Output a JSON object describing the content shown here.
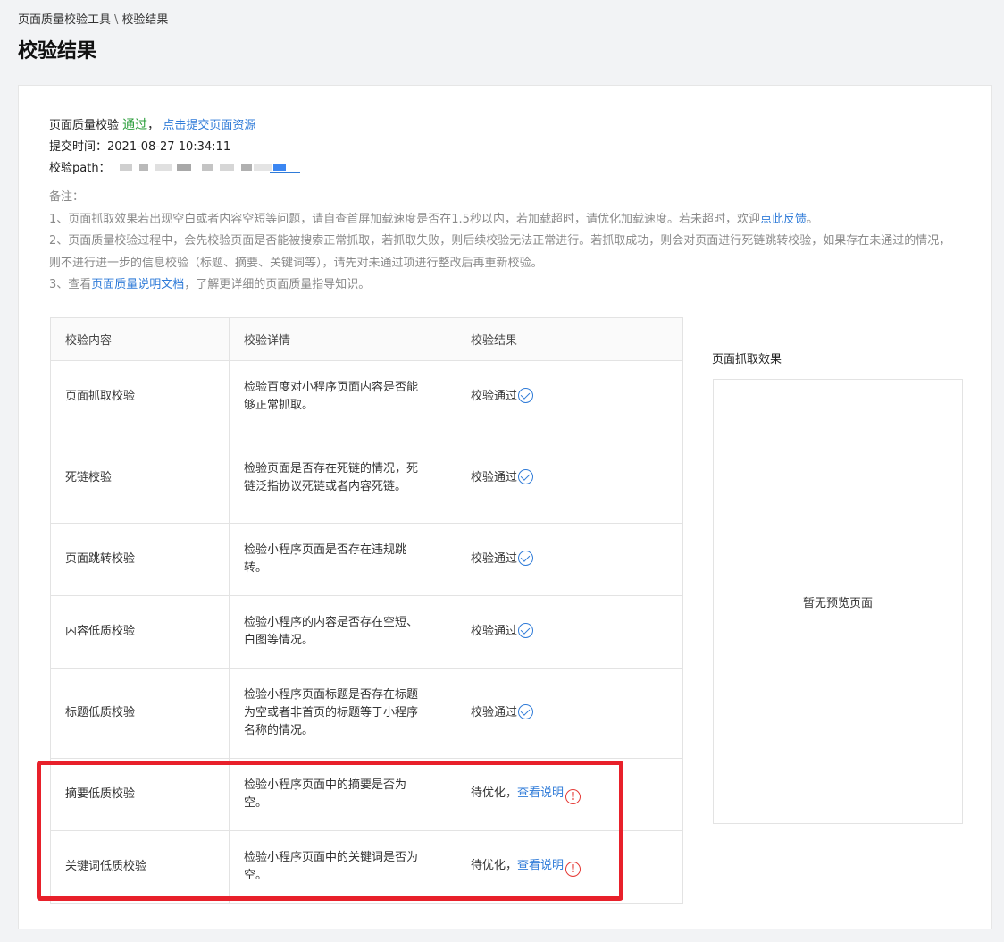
{
  "breadcrumb": {
    "root": "页面质量校验工具",
    "separator": "\\",
    "current": "校验结果"
  },
  "page_title": "校验结果",
  "summary": {
    "status_prefix": "页面质量校验",
    "status_word": "通过",
    "comma": "，",
    "submit_link": "点击提交页面资源",
    "submit_time_label": "提交时间：",
    "submit_time_value": "2021-08-27 10:34:11",
    "path_label": "校验path："
  },
  "notes": {
    "title": "备注：",
    "n1_text": "1、页面抓取效果若出现空白或者内容空短等问题，请自查首屏加载速度是否在1.5秒以内，若加载超时，请优化加载速度。若未超时，欢迎",
    "n1_link": "点此反馈",
    "n1_end": "。",
    "n2_text": "2、页面质量校验过程中，会先校验页面是否能被搜索正常抓取，若抓取失败，则后续校验无法正常进行。若抓取成功，则会对页面进行死链跳转校验，如果存在未通过的情况，则不进行进一步的信息校验（标题、摘要、关键词等），请先对未通过项进行整改后再重新校验。",
    "n3_start": "3、查看",
    "n3_link": "页面质量说明文档",
    "n3_end": "，了解更详细的页面质量指导知识。"
  },
  "table": {
    "headers": [
      "校验内容",
      "校验详情",
      "校验结果"
    ],
    "rows": [
      {
        "item": "页面抓取校验",
        "detail": "检验百度对小程序页面内容是否能够正常抓取。",
        "result": "校验通过",
        "status": "pass"
      },
      {
        "item": "死链校验",
        "detail": "检验页面是否存在死链的情况，死链泛指协议死链或者内容死链。",
        "result": "校验通过",
        "status": "pass"
      },
      {
        "item": "页面跳转校验",
        "detail": "检验小程序页面是否存在违规跳转。",
        "result": "校验通过",
        "status": "pass"
      },
      {
        "item": "内容低质校验",
        "detail": "检验小程序的内容是否存在空短、白图等情况。",
        "result": "校验通过",
        "status": "pass"
      },
      {
        "item": "标题低质校验",
        "detail": "检验小程序页面标题是否存在标题为空或者非首页的标题等于小程序名称的情况。",
        "result": "校验通过",
        "status": "pass"
      },
      {
        "item": "摘要低质校验",
        "detail": "检验小程序页面中的摘要是否为空。",
        "result": "待优化，",
        "link": "查看说明",
        "status": "warn"
      },
      {
        "item": "关键词低质校验",
        "detail": "检验小程序页面中的关键词是否为空。",
        "result": "待优化，",
        "link": "查看说明",
        "status": "warn"
      }
    ]
  },
  "preview": {
    "title": "页面抓取效果",
    "empty_text": "暂无预览页面"
  },
  "icons": {
    "pass": "check-circle-icon",
    "warn": "exclamation-circle-icon"
  },
  "colors": {
    "pass_text": "#2a9d3a",
    "link": "#2f7bd8",
    "warn": "#e53935",
    "highlight": "#e8202a"
  }
}
